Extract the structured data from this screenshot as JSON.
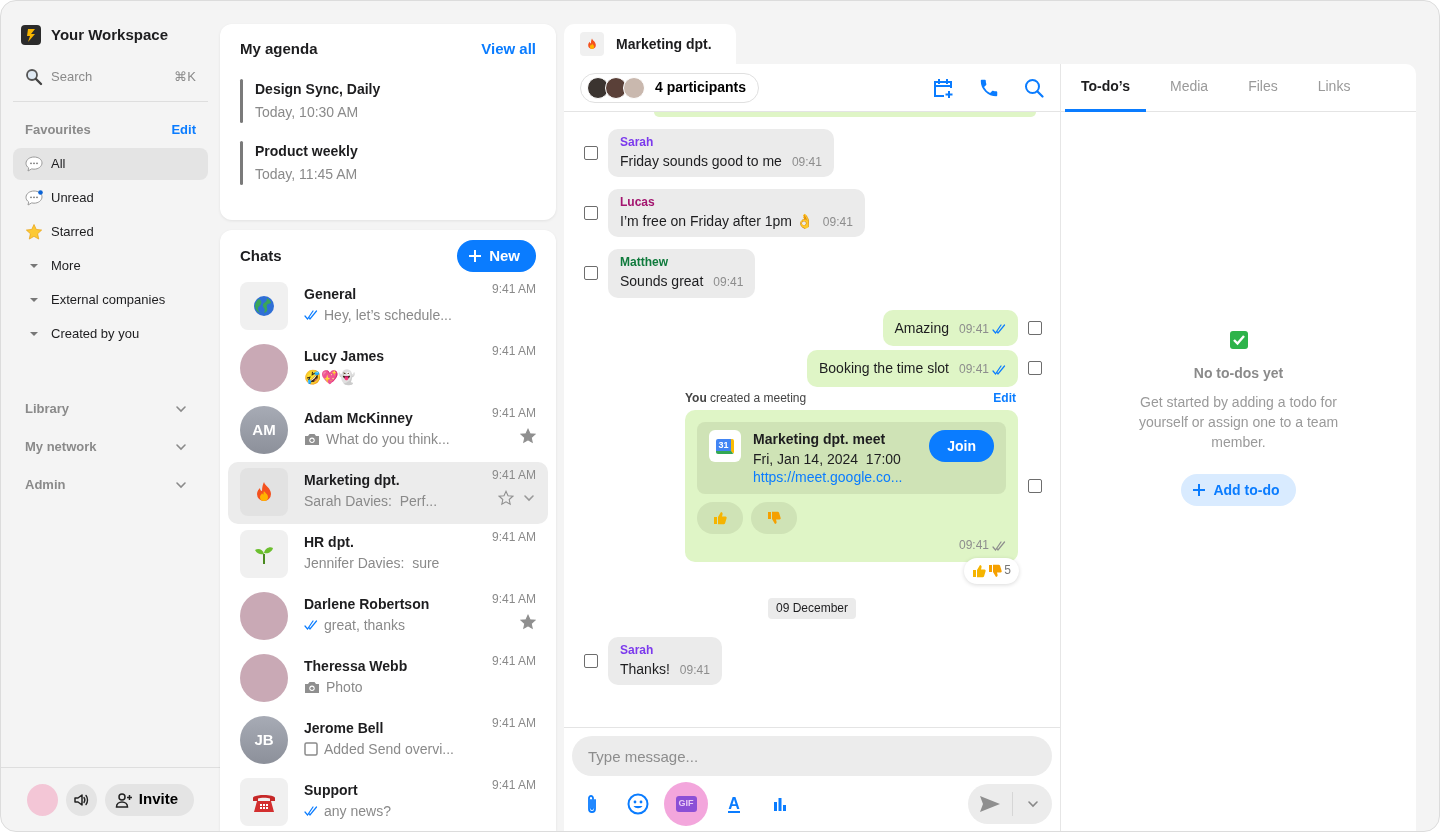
{
  "workspace": {
    "name": "Your Workspace"
  },
  "search": {
    "placeholder": "Search",
    "shortcut": "⌘K"
  },
  "favourites": {
    "title": "Favourites",
    "action": "Edit",
    "items": [
      {
        "label": "All",
        "kind": "chat",
        "selected": true
      },
      {
        "label": "Unread",
        "kind": "unread",
        "selected": false
      },
      {
        "label": "Starred",
        "kind": "star",
        "selected": false
      },
      {
        "label": "More",
        "kind": "group",
        "selected": false
      },
      {
        "label": "External companies",
        "kind": "group",
        "selected": false
      },
      {
        "label": "Created by you",
        "kind": "group",
        "selected": false
      }
    ]
  },
  "sections": [
    {
      "label": "Library"
    },
    {
      "label": "My network"
    },
    {
      "label": "Admin"
    }
  ],
  "footer": {
    "invite": "Invite"
  },
  "agenda": {
    "title": "My agenda",
    "action": "View all",
    "events": [
      {
        "title": "Design Sync, Daily",
        "time": "Today, 10:30 AM"
      },
      {
        "title": "Product weekly",
        "time": "Today, 11:45 AM"
      }
    ]
  },
  "chats": {
    "title": "Chats",
    "new_label": "New",
    "items": [
      {
        "name": "General",
        "time": "9:41 AM",
        "preview": "Hey, let’s schedule...",
        "avatar": {
          "kind": "globe"
        },
        "status": {
          "kind": "read"
        },
        "starred": false,
        "selected": false
      },
      {
        "name": "Lucy James",
        "time": "9:41 AM",
        "preview": "🤣💖👻",
        "avatar": {
          "kind": "photo"
        },
        "starred": false,
        "selected": false
      },
      {
        "name": "Adam McKinney",
        "time": "9:41 AM",
        "preview": "What do you think...",
        "avatar": {
          "kind": "initials",
          "initials": "AM"
        },
        "status": {
          "kind": "photo"
        },
        "starred": true,
        "selected": false
      },
      {
        "name": "Marketing dpt.",
        "time": "9:41 AM",
        "preview": "Sarah Davies:  Perf...",
        "avatar": {
          "kind": "fire"
        },
        "starred": false,
        "selected": true
      },
      {
        "name": "HR dpt.",
        "time": "9:41 AM",
        "preview": "Jennifer Davies:  sure",
        "avatar": {
          "kind": "sprout"
        },
        "starred": false,
        "selected": false
      },
      {
        "name": "Darlene Robertson",
        "time": "9:41 AM",
        "preview": "great, thanks",
        "avatar": {
          "kind": "photo"
        },
        "status": {
          "kind": "read"
        },
        "starred": true,
        "selected": false
      },
      {
        "name": "Theressa Webb",
        "time": "9:41 AM",
        "preview": "Photo",
        "avatar": {
          "kind": "photo"
        },
        "status": {
          "kind": "photo"
        },
        "starred": false,
        "selected": false
      },
      {
        "name": "Jerome Bell",
        "time": "9:41 AM",
        "preview": "Added Send overvi...",
        "avatar": {
          "kind": "initials",
          "initials": "JB"
        },
        "status": {
          "kind": "todo"
        },
        "starred": false,
        "selected": false
      },
      {
        "name": "Support",
        "time": "9:41 AM",
        "preview": "any news?",
        "avatar": {
          "kind": "phone"
        },
        "status": {
          "kind": "read"
        },
        "starred": false,
        "selected": false
      }
    ]
  },
  "conversation": {
    "title": "Marketing dpt.",
    "participants": "4 participants",
    "messages": [
      {
        "kind": "incoming",
        "sender": "Sarah",
        "color": "#7c3aed",
        "text": "Friday sounds good to me",
        "time": "09:41",
        "checked": false
      },
      {
        "kind": "incoming",
        "sender": "Lucas",
        "color": "#a3156f",
        "text": "I’m free on Friday after 1pm 👌",
        "time": "09:41",
        "checked": false
      },
      {
        "kind": "incoming",
        "sender": "Matthew",
        "color": "#0f7a3c",
        "text": "Sounds great",
        "time": "09:41",
        "checked": false
      },
      {
        "kind": "outgoing",
        "text": "Amazing",
        "time": "09:41",
        "read": true,
        "checked": false
      },
      {
        "kind": "outgoing",
        "text": "Booking the time slot",
        "time": "09:41",
        "read": true,
        "checked": false
      },
      {
        "kind": "meeting",
        "note": "**You** created a meeting",
        "action": "Edit",
        "calendar_day": "31",
        "title": "Marketing dpt. meet",
        "when": "Fri, Jan 14, 2024  17:00",
        "link": "https://meet.google.co...",
        "join": "Join",
        "time": "09:41",
        "read": false,
        "reaction_count": "5",
        "checked": false
      },
      {
        "kind": "date",
        "text": "09 December"
      },
      {
        "kind": "incoming",
        "sender": "Sarah",
        "color": "#7c3aed",
        "text": "Thanks!",
        "time": "09:41",
        "checked": false
      }
    ],
    "composer": {
      "placeholder": "Type message...",
      "tools": [
        {
          "kind": "attach",
          "active": false
        },
        {
          "kind": "emoji",
          "active": false
        },
        {
          "kind": "gif",
          "label": "GIF",
          "active": true
        },
        {
          "kind": "format",
          "label": "A",
          "active": false
        },
        {
          "kind": "poll",
          "active": false
        }
      ]
    }
  },
  "details": {
    "tabs": [
      {
        "label": "To-do’s",
        "selected": true
      },
      {
        "label": "Media",
        "selected": false
      },
      {
        "label": "Files",
        "selected": false
      },
      {
        "label": "Links",
        "selected": false
      }
    ],
    "empty": {
      "title": "No to-dos yet",
      "text": "Get started by adding a todo for yourself or assign one to a team member.",
      "button": "Add to-do"
    }
  }
}
